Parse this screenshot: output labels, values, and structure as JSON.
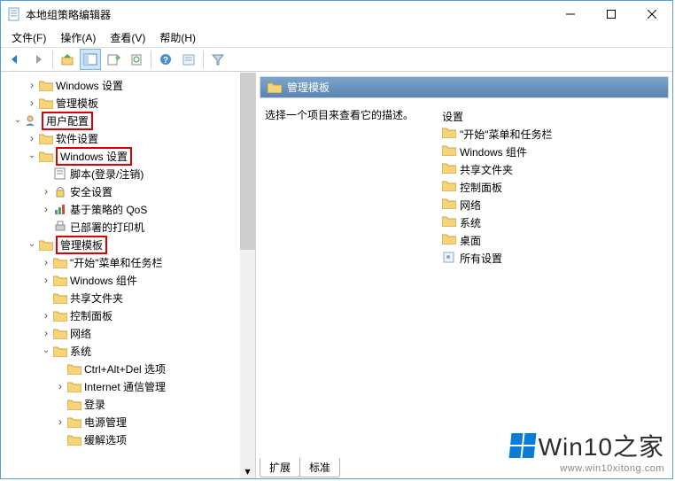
{
  "window": {
    "title": "本地组策略编辑器"
  },
  "menu": {
    "file": "文件(F)",
    "action": "操作(A)",
    "view": "查看(V)",
    "help": "帮助(H)"
  },
  "tree": {
    "n0": "Windows 设置",
    "n1": "管理模板",
    "n2": "用户配置",
    "n3": "软件设置",
    "n4": "Windows 设置",
    "n5": "脚本(登录/注销)",
    "n6": "安全设置",
    "n7": "基于策略的 QoS",
    "n8": "已部署的打印机",
    "n9": "管理模板",
    "n10": "\"开始\"菜单和任务栏",
    "n11": "Windows 组件",
    "n12": "共享文件夹",
    "n13": "控制面板",
    "n14": "网络",
    "n15": "系统",
    "n16": "Ctrl+Alt+Del 选项",
    "n17": "Internet 通信管理",
    "n18": "登录",
    "n19": "电源管理",
    "n20": "缓解选项"
  },
  "header": {
    "title": "管理模板"
  },
  "desc": {
    "prompt": "选择一个项目来查看它的描述。"
  },
  "list": {
    "col": "设置",
    "i0": "\"开始\"菜单和任务栏",
    "i1": "Windows 组件",
    "i2": "共享文件夹",
    "i3": "控制面板",
    "i4": "网络",
    "i5": "系统",
    "i6": "桌面",
    "i7": "所有设置"
  },
  "tabs": {
    "t0": "扩展",
    "t1": "标准"
  },
  "watermark": {
    "brand": "Win10",
    "suffix": "之家",
    "url": "www.win10xitong.com"
  }
}
